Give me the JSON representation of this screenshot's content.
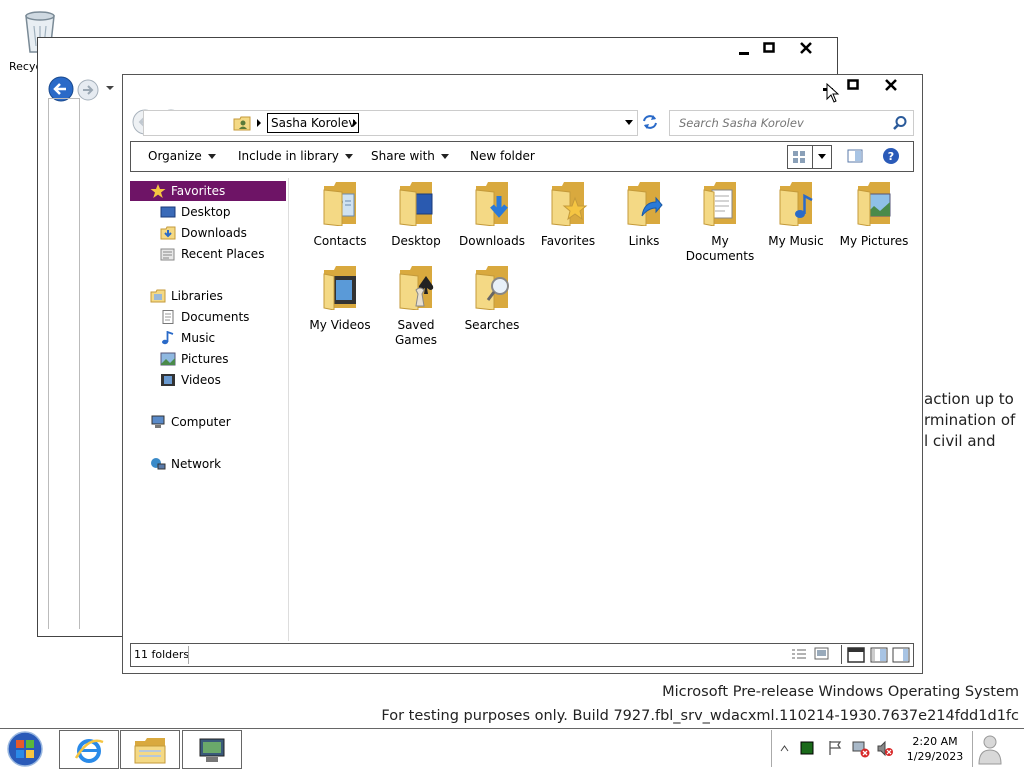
{
  "desktop": {
    "recycle_label": "Recyc",
    "bg_text_lines": [
      "action up to",
      "rmination of",
      "l civil and"
    ],
    "watermark_line1": "Microsoft Pre-release Windows Operating System",
    "watermark_line2": "For testing purposes only. Build 7927.fbl_srv_wdacxml.110214-1930.7637e214fdd1d1fc"
  },
  "back_window": {
    "icons": [
      "back-arrow-icon",
      "forward-arrow-icon",
      "dropdown-arrow-icon"
    ]
  },
  "window": {
    "breadcrumb": "Sasha Korolev",
    "search_placeholder": "Search Sasha Korolev",
    "toolbar": {
      "organize": "Organize",
      "include_in_library": "Include in library",
      "share_with": "Share with",
      "new_folder": "New folder"
    },
    "nav": {
      "favorites": "Favorites",
      "desktop": "Desktop",
      "downloads": "Downloads",
      "recent_places": "Recent Places",
      "libraries": "Libraries",
      "documents": "Documents",
      "music": "Music",
      "pictures": "Pictures",
      "videos": "Videos",
      "computer": "Computer",
      "network": "Network"
    },
    "items": [
      {
        "line1": "Contacts",
        "line2": ""
      },
      {
        "line1": "Desktop",
        "line2": ""
      },
      {
        "line1": "Downloads",
        "line2": ""
      },
      {
        "line1": "Favorites",
        "line2": ""
      },
      {
        "line1": "Links",
        "line2": ""
      },
      {
        "line1": "My",
        "line2": "Documents"
      },
      {
        "line1": "My Music",
        "line2": ""
      },
      {
        "line1": "My Pictures",
        "line2": ""
      },
      {
        "line1": "My Videos",
        "line2": ""
      },
      {
        "line1": "Saved",
        "line2": "Games"
      },
      {
        "line1": "Searches",
        "line2": ""
      }
    ],
    "status": "11 folders"
  },
  "taskbar": {
    "time": "2:20 AM",
    "date": "1/29/2023"
  },
  "colors": {
    "nav_selected": "#6e1466",
    "folder_yellow": "#f4d985",
    "folder_dark": "#d9a93e"
  }
}
